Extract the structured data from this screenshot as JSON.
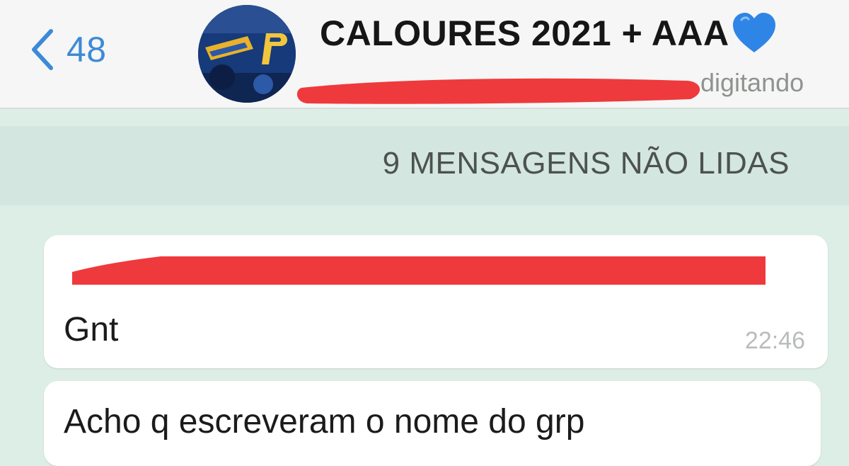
{
  "header": {
    "back_count": "48",
    "title": "CALOURES 2021 + AAA",
    "status": "digitando"
  },
  "unread_banner": "9 MENSAGENS NÃO LIDAS",
  "messages": [
    {
      "text": "Gnt",
      "time": "22:46"
    },
    {
      "text": "Acho q escreveram o nome do grp"
    }
  ],
  "icons": {
    "back": "chevron-left-icon",
    "heart": "blue-heart-icon"
  },
  "colors": {
    "accent": "#3d8ad6",
    "redaction": "#ee3a3c",
    "chat_background": "#ddeee6",
    "heart": "#2f85e6"
  }
}
